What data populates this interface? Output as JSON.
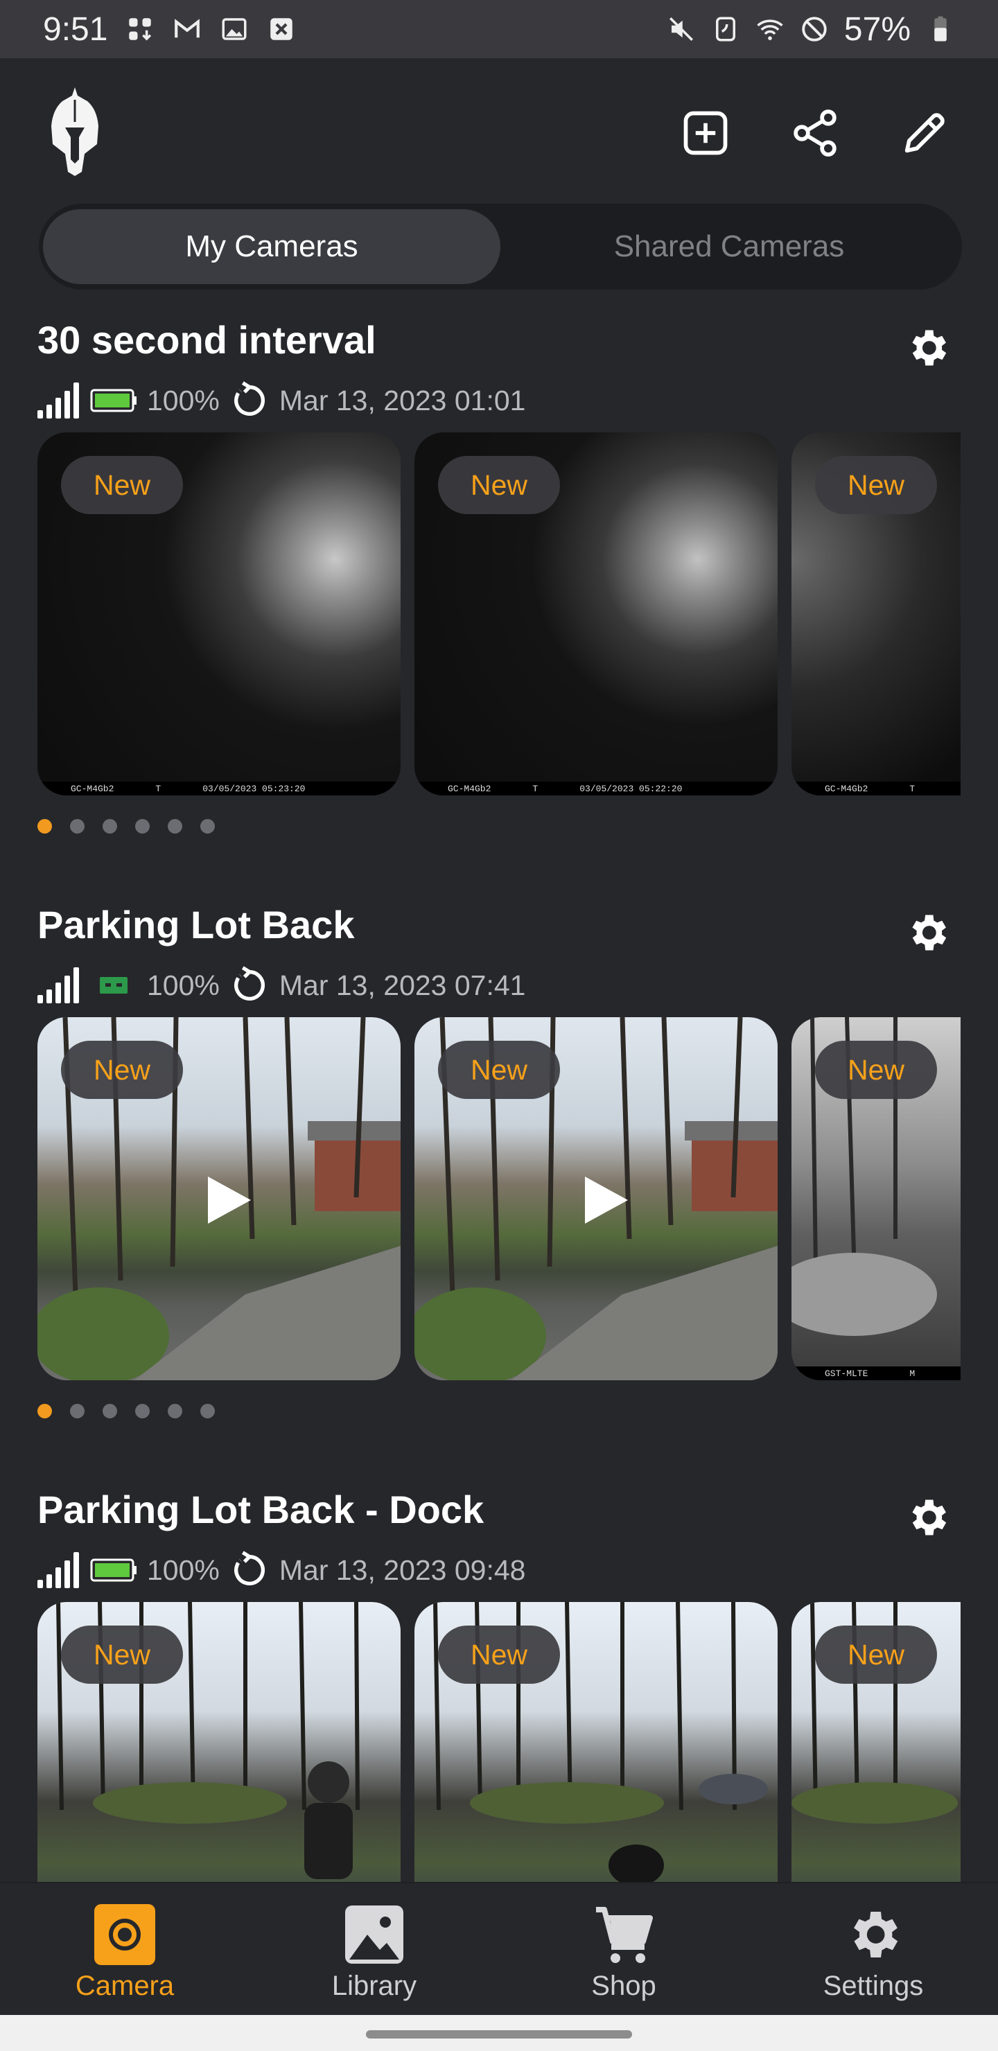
{
  "status_bar": {
    "time": "9:51",
    "battery": "57%"
  },
  "tabs": {
    "my_cameras": "My Cameras",
    "shared_cameras": "Shared Cameras"
  },
  "colors": {
    "accent": "#f7a11a",
    "background": "#26272b",
    "battery_green": "#5ec93d",
    "battery_dark_green": "#2c9a4a"
  },
  "cameras": [
    {
      "title": "30 second interval",
      "battery": "100%",
      "updated": "Mar 13, 2023 01:01",
      "thumbs": [
        {
          "badge": "New",
          "stamp_model": "GC-M4Gb2",
          "stamp_flag": "T",
          "stamp_time": "03/05/2023 05:23:20"
        },
        {
          "badge": "New",
          "stamp_model": "GC-M4Gb2",
          "stamp_flag": "T",
          "stamp_time": "03/05/2023 05:22:20"
        },
        {
          "badge": "New",
          "stamp_model": "GC-M4Gb2",
          "stamp_flag": "T"
        }
      ]
    },
    {
      "title": "Parking Lot Back",
      "battery": "100%",
      "updated": "Mar 13, 2023 07:41",
      "thumbs": [
        {
          "badge": "New"
        },
        {
          "badge": "New"
        },
        {
          "badge": "New",
          "stamp_model": "GST-MLTE",
          "stamp_flag": "M"
        }
      ]
    },
    {
      "title": "Parking Lot Back - Dock",
      "battery": "100%",
      "updated": "Mar 13, 2023 09:48",
      "thumbs": [
        {
          "badge": "New"
        },
        {
          "badge": "New"
        },
        {
          "badge": "New"
        }
      ]
    }
  ],
  "nav": {
    "camera": "Camera",
    "library": "Library",
    "shop": "Shop",
    "settings": "Settings"
  }
}
